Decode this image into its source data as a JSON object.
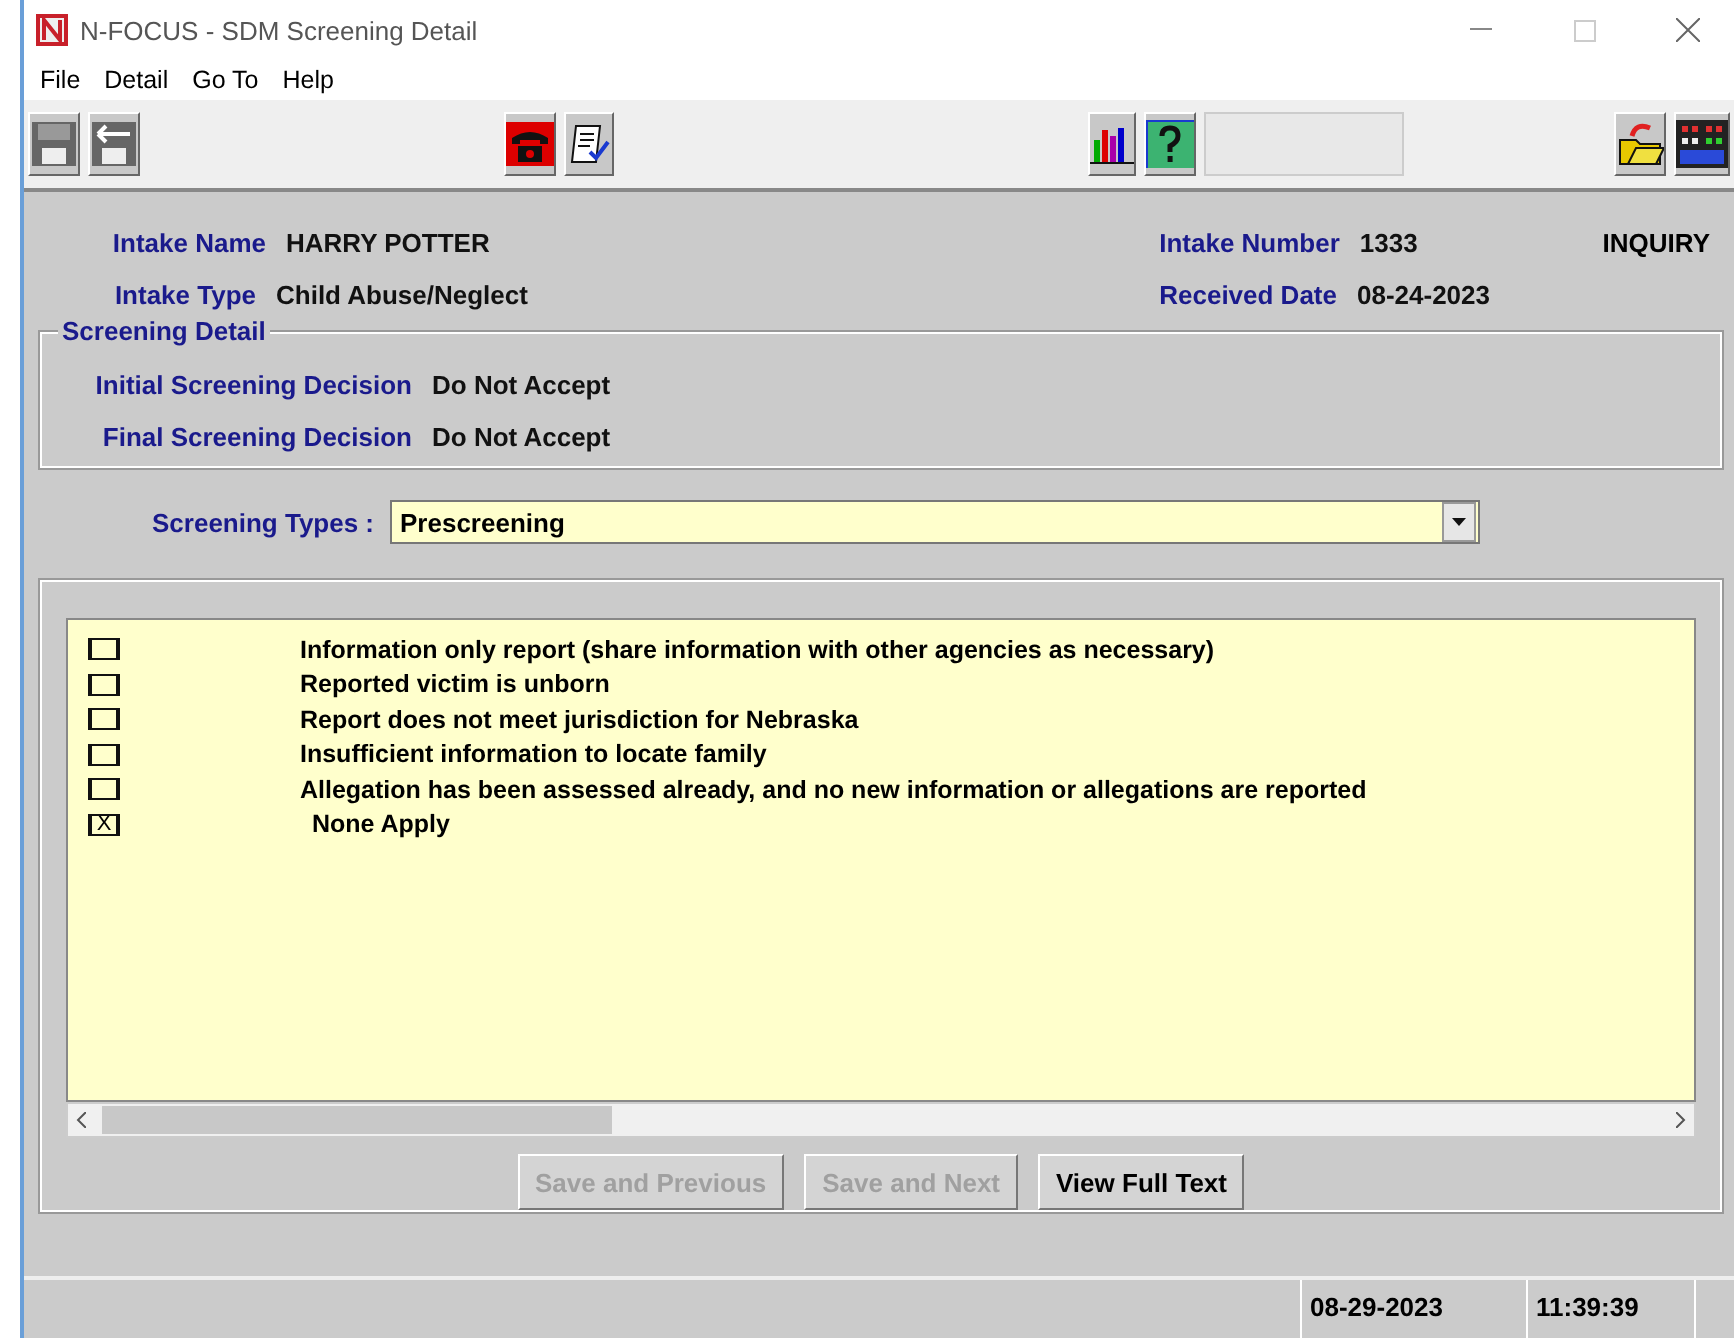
{
  "window": {
    "title": "N-FOCUS - SDM Screening Detail"
  },
  "menu": [
    "File",
    "Detail",
    "Go To",
    "Help"
  ],
  "header": {
    "fields": [
      {
        "label": "Intake Name",
        "value": "HARRY POTTER"
      },
      {
        "label": "Intake Type",
        "value": "Child Abuse/Neglect"
      }
    ],
    "right_fields": [
      {
        "label": "Intake Number",
        "value": "1333"
      },
      {
        "label": "Received Date",
        "value": "08-24-2023"
      }
    ],
    "status": "INQUIRY"
  },
  "screening_detail": {
    "title": "Screening Detail",
    "fields": [
      {
        "label": "Initial Screening Decision",
        "value": "Do Not Accept"
      },
      {
        "label": "Final Screening Decision",
        "value": "Do Not Accept"
      }
    ]
  },
  "screening_types": {
    "label": "Screening Types :",
    "value": "Prescreening"
  },
  "check_glyph": "X",
  "items": [
    {
      "label": "Information only report (share information with other agencies as necessary)",
      "checked": false
    },
    {
      "label": "Reported victim is unborn",
      "checked": false
    },
    {
      "label": "Report does not meet jurisdiction for Nebraska",
      "checked": false
    },
    {
      "label": "Insufficient information to locate family",
      "checked": false
    },
    {
      "label": "Allegation has been assessed already, and no new information or allegations are reported",
      "checked": false
    },
    {
      "label": "None Apply",
      "checked": true
    }
  ],
  "buttons": [
    {
      "label": "Save and Previous",
      "disabled": true
    },
    {
      "label": "Save and Next",
      "disabled": true
    },
    {
      "label": "View Full Text",
      "disabled": false
    }
  ],
  "status_bar": {
    "date": "08-29-2023",
    "time": "11:39:39"
  }
}
